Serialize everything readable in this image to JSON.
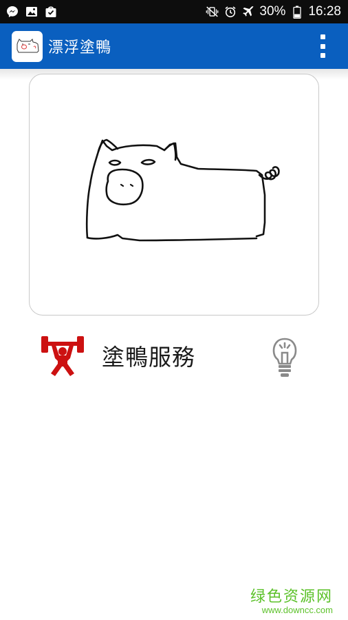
{
  "status_bar": {
    "battery_percent": "30%",
    "time": "16:28",
    "left_icons": [
      "messenger-icon",
      "gallery-icon",
      "shopping-bag-icon"
    ],
    "right_icons": [
      "vibrate-mute-icon",
      "alarm-icon",
      "airplane-mode-icon",
      "battery-icon"
    ]
  },
  "app_bar": {
    "title": "漂浮塗鴨",
    "color": "#0a5fbf",
    "menu_icon": "overflow-menu-icon"
  },
  "canvas": {
    "drawing": "pig-sketch"
  },
  "service": {
    "title": "塗鴨服務",
    "left_icon": "weightlifter-icon",
    "left_icon_color": "#cc1111",
    "right_icon": "lightbulb-icon"
  },
  "watermark": {
    "main": "绿色资源网",
    "sub": "www.downcc.com",
    "color": "#5cc12a"
  }
}
